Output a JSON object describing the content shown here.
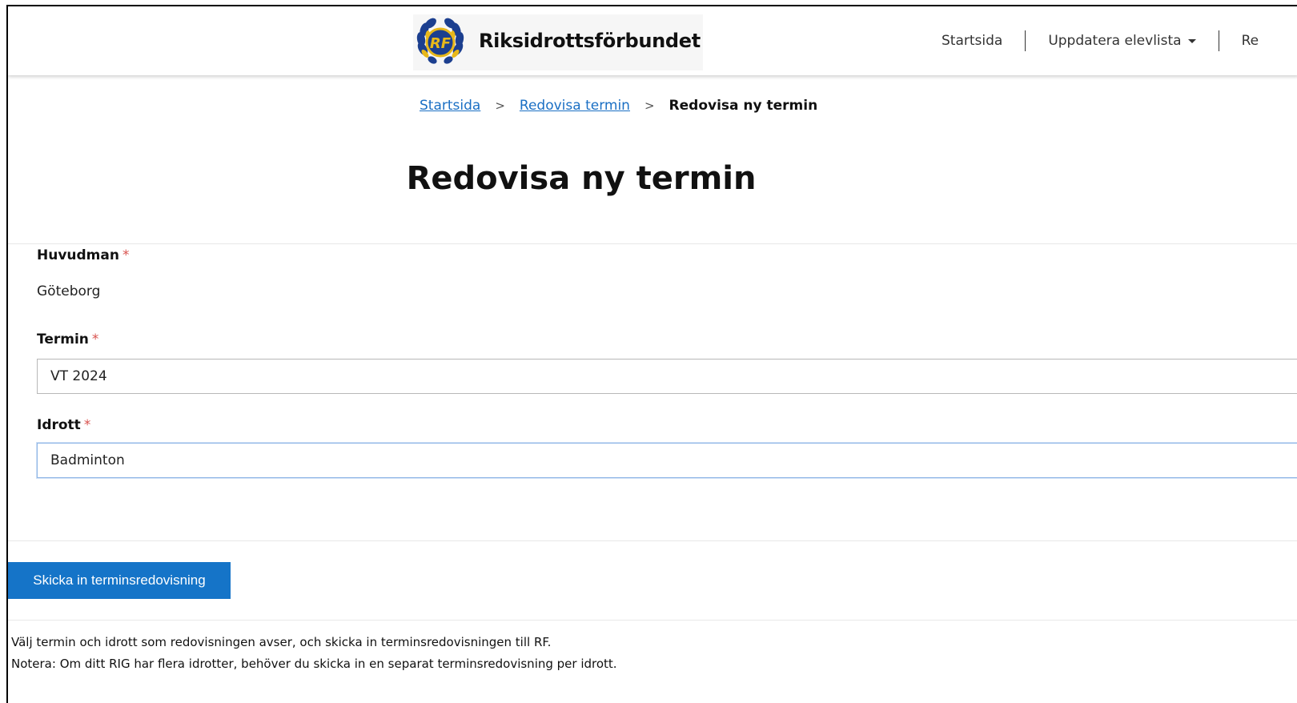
{
  "header": {
    "logo_text": "Riksidrottsförbundet",
    "logo_emblem_letters": "RF",
    "nav": [
      {
        "label": "Startsida"
      },
      {
        "label": "Uppdatera elevlista"
      },
      {
        "label": "Re"
      }
    ]
  },
  "breadcrumb": {
    "items": [
      "Startsida",
      "Redovisa termin"
    ],
    "separator": ">",
    "current": "Redovisa ny termin"
  },
  "page_title": "Redovisa ny termin",
  "form": {
    "required_mark": "*",
    "huvudman": {
      "label": "Huvudman",
      "value": "Göteborg"
    },
    "termin": {
      "label": "Termin",
      "value": "VT 2024"
    },
    "idrott": {
      "label": "Idrott",
      "value": "Badminton"
    }
  },
  "submit_label": "Skicka in terminsredovisning",
  "help": [
    "Välj termin och idrott som redovisningen avser, och skicka in terminsredovisningen till RF.",
    "Notera: Om ditt RIG har flera idrotter, behöver du skicka in en separat terminsredovisning per idrott."
  ],
  "colors": {
    "accent": "#1574c8",
    "link": "#1a6fc4",
    "required": "#d9534f",
    "emblem_blue": "#1c3f8f",
    "emblem_gold": "#e8b81a"
  }
}
